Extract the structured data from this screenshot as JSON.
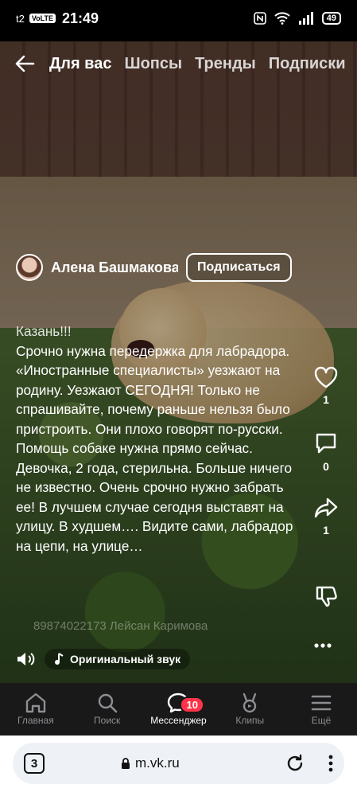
{
  "status_bar": {
    "carrier": "t2",
    "carrier_badge": "VoLTE",
    "time": "21:49",
    "battery": "49"
  },
  "top_nav": {
    "tabs": [
      {
        "label": "Для вас",
        "active": true
      },
      {
        "label": "Шопсы",
        "active": false
      },
      {
        "label": "Тренды",
        "active": false
      },
      {
        "label": "Подписки",
        "active": false
      }
    ]
  },
  "post": {
    "author": "Алена Башмакова",
    "subscribe_label": "Подписаться",
    "city_line": "Казань!!!",
    "body": "Срочно нужна передержка для лабрадора. «Иностранные специалисты» уезжают на родину. Уезжают СЕГОДНЯ! Только не спрашивайте, почему раньше нельзя было пристроить. Они плохо говорят по-русски. Помощь собаке нужна прямо сейчас. Девочка, 2 года, стерильна. Больше ничего не известно. Очень срочно нужно забрать ее! В лучшем случае сегодня выставят на улицу. В худшем…. Видите сами, лабрадор на цепи, на улице…",
    "faint_line": "89874022173 Лейсан Каримова"
  },
  "actions": {
    "likes": "1",
    "comments": "0",
    "shares": "1"
  },
  "sound": {
    "label": "Оригинальный звук"
  },
  "tabbar": {
    "items": [
      {
        "label": "Главная",
        "icon": "home-icon"
      },
      {
        "label": "Поиск",
        "icon": "search-icon"
      },
      {
        "label": "Мессенджер",
        "icon": "messenger-icon",
        "badge": "10",
        "active": true
      },
      {
        "label": "Клипы",
        "icon": "clips-icon"
      },
      {
        "label": "Ещё",
        "icon": "menu-icon"
      }
    ]
  },
  "browser": {
    "tab_count": "3",
    "url": "m.vk.ru"
  }
}
